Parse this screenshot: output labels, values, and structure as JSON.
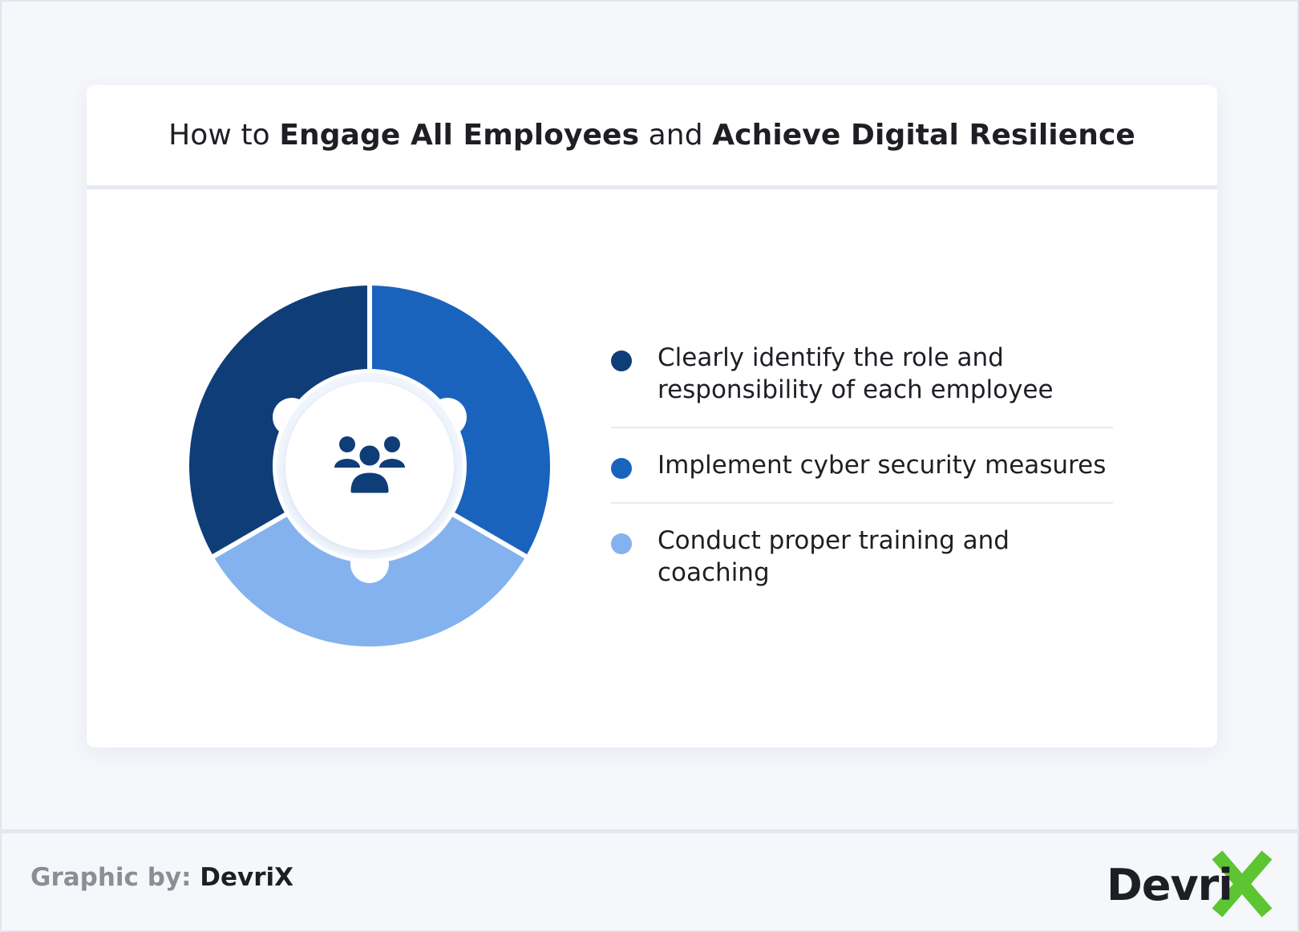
{
  "title": {
    "part1": "How to ",
    "part2": "Engage All Employees",
    "part3": " and ",
    "part4": "Achieve Digital Resilience"
  },
  "diagram": {
    "center_icon": "people-group-icon",
    "segments": [
      {
        "label": "Clearly identify the role and responsibility of each employee",
        "color": "#0f3d78"
      },
      {
        "label": "Implement cyber security measures",
        "color": "#1a63bd"
      },
      {
        "label": "Conduct proper training and coaching",
        "color": "#84b2ee"
      }
    ]
  },
  "legend": {
    "items": [
      {
        "line1": "Clearly identify the role and",
        "line2": "responsibility of each employee",
        "color": "#0f3d78"
      },
      {
        "line1": "Implement cyber security measures",
        "color": "#1a63bd"
      },
      {
        "line1": "Conduct proper training and coaching",
        "color": "#84b2ee"
      }
    ]
  },
  "footer": {
    "credit_prefix": "Graphic by: ",
    "credit_brand": "DevriX",
    "logo_text": "Devri",
    "logo_mark": "X",
    "logo_mark_color": "#5cc531"
  }
}
